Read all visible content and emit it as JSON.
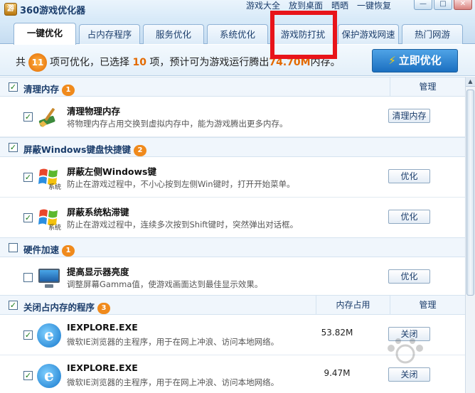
{
  "app": {
    "title": "360游戏优化器",
    "icon_text": "游"
  },
  "top_links": [
    "游戏大全",
    "放到桌面",
    "晒晒",
    "一键恢复"
  ],
  "window_buttons": {
    "minimize": "—",
    "maximize": "□",
    "close": "✕"
  },
  "tabs": [
    {
      "label": "一键优化",
      "active": true
    },
    {
      "label": "占内存程序",
      "active": false
    },
    {
      "label": "服务优化",
      "active": false
    },
    {
      "label": "系统优化",
      "active": false
    },
    {
      "label": "游戏防打扰",
      "active": false
    },
    {
      "label": "保护游戏网速",
      "active": false
    },
    {
      "label": "热门网游",
      "active": false
    }
  ],
  "summary": {
    "prefix": "共",
    "count": "11",
    "mid1": "项可优化，已选择",
    "selected": "10",
    "mid2": "项，预计可为游戏运行腾出",
    "memory": "74.70M",
    "suffix": "内存。"
  },
  "optimize_button": {
    "label": "立即优化",
    "icon": "lightning-icon"
  },
  "sections": [
    {
      "title": "清理内存",
      "badge": "1",
      "checked": true,
      "col_manage": "管理",
      "items": [
        {
          "name": "清理物理内存",
          "desc": "将物理内存占用交换到虚拟内存中，能为游戏腾出更多内存。",
          "button": "清理内存",
          "checked": true,
          "icon": "broom-icon"
        }
      ]
    },
    {
      "title": "屏蔽Windows键盘快捷键",
      "badge": "2",
      "checked": true,
      "items": [
        {
          "name": "屏蔽左侧Windows键",
          "desc": "防止在游戏过程中，不小心按到左侧Win键时，打开开始菜单。",
          "button": "优化",
          "checked": true,
          "icon": "windows-icon",
          "icon_label": "系统"
        },
        {
          "name": "屏蔽系统粘滞键",
          "desc": "防止在游戏过程中，连续多次按到Shift键时，突然弹出对话框。",
          "button": "优化",
          "checked": true,
          "icon": "windows-icon",
          "icon_label": "系统"
        }
      ]
    },
    {
      "title": "硬件加速",
      "badge": "1",
      "checked": false,
      "items": [
        {
          "name": "提高显示器亮度",
          "desc": "调整屏幕Gamma值，使游戏画面达到最佳显示效果。",
          "button": "优化",
          "checked": false,
          "icon": "monitor-icon"
        }
      ]
    },
    {
      "title": "关闭占内存的程序",
      "badge": "3",
      "checked": true,
      "col_memory": "内存占用",
      "col_manage": "管理",
      "items": [
        {
          "name": "IEXPLORE.EXE",
          "desc": "微软IE浏览器的主程序，用于在网上冲浪、访问本地网络。",
          "memory": "53.82M",
          "button": "关闭",
          "checked": true,
          "icon": "ie-icon"
        },
        {
          "name": "IEXPLORE.EXE",
          "desc": "微软IE浏览器的主程序，用于在网上冲浪、访问本地网络。",
          "memory": "9.47M",
          "button": "关闭",
          "checked": true,
          "icon": "ie-icon"
        }
      ]
    }
  ],
  "checkmark": "✓",
  "colors": {
    "accent_orange": "#e36a00",
    "highlight_red": "#e8141a",
    "primary_blue": "#1b6fc0"
  }
}
